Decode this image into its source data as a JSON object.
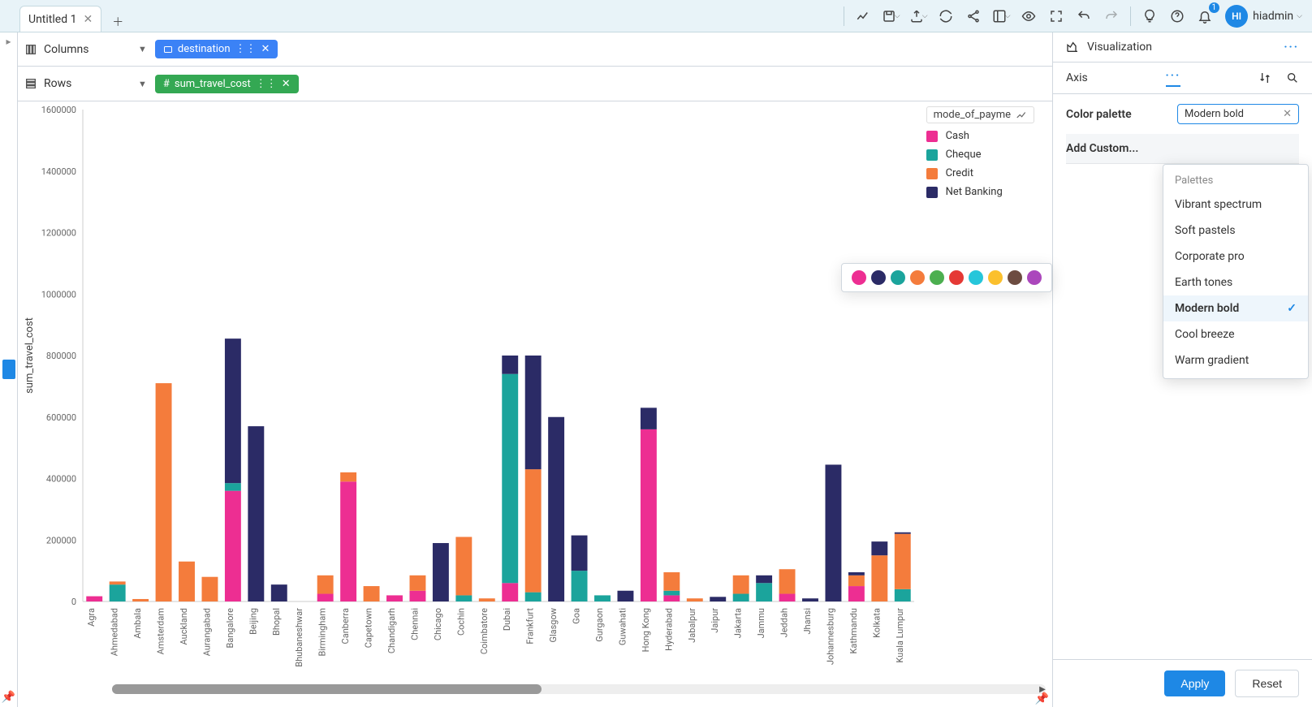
{
  "tab": {
    "title": "Untitled 1"
  },
  "user": {
    "initials": "HI",
    "name": "hiadmin"
  },
  "notif_count": "1",
  "shelves": {
    "columns_label": "Columns",
    "rows_label": "Rows",
    "column_pill": "destination",
    "row_pill": "sum_travel_cost"
  },
  "legend": {
    "title": "mode_of_payme",
    "items": [
      "Cash",
      "Cheque",
      "Credit",
      "Net Banking"
    ]
  },
  "right": {
    "title": "Visualization",
    "tab": "Axis",
    "field_label": "Color palette",
    "field_value": "Modern bold",
    "add_custom": "Add Custom...",
    "apply": "Apply",
    "reset": "Reset"
  },
  "palette_dropdown": {
    "header": "Palettes",
    "options": [
      "Vibrant spectrum",
      "Soft pastels",
      "Corporate pro",
      "Earth tones",
      "Modern bold",
      "Cool breeze",
      "Warm gradient"
    ],
    "selected": "Modern bold"
  },
  "swatches": [
    "#ed2e92",
    "#2b2b66",
    "#1ba49c",
    "#f47c3c",
    "#4caf50",
    "#e53935",
    "#26c6da",
    "#fbc02d",
    "#6d4c41",
    "#ab47bc"
  ],
  "chart_data": {
    "type": "bar",
    "stacked": true,
    "title": "",
    "xlabel": "destination",
    "ylabel": "sum_travel_cost",
    "ylim": [
      0,
      1600000
    ],
    "yticks": [
      0,
      200000,
      400000,
      600000,
      800000,
      1000000,
      1200000,
      1400000,
      1600000
    ],
    "legend_title": "mode_of_payment",
    "series_order": [
      "Cash",
      "Cheque",
      "Credit",
      "Net Banking"
    ],
    "colors": {
      "Cash": "#ed2e92",
      "Cheque": "#1ba49c",
      "Credit": "#f47c3c",
      "Net Banking": "#2b2b66"
    },
    "categories": [
      "Agra",
      "Ahmedabad",
      "Ambala",
      "Amsterdam",
      "Auckland",
      "Aurangabad",
      "Bangalore",
      "Beijing",
      "Bhopal",
      "Bhubaneshwar",
      "Birmingham",
      "Canberra",
      "Capetown",
      "Chandigarh",
      "Chennai",
      "Chicago",
      "Cochin",
      "Coimbatore",
      "Dubai",
      "Frankfurt",
      "Glasgow",
      "Goa",
      "Gurgaon",
      "Guwahati",
      "Hong Kong",
      "Hyderabad",
      "Jabalpur",
      "Jaipur",
      "Jakarta",
      "Jammu",
      "Jeddah",
      "Jhansi",
      "Johannesburg",
      "Kathmandu",
      "Kolkata",
      "Kuala Lumpur"
    ],
    "series": [
      {
        "name": "Cash",
        "values": [
          17000,
          0,
          0,
          0,
          0,
          0,
          360000,
          0,
          0,
          0,
          25000,
          390000,
          0,
          20000,
          35000,
          0,
          0,
          0,
          60000,
          0,
          0,
          0,
          0,
          0,
          560000,
          20000,
          0,
          0,
          0,
          0,
          25000,
          0,
          0,
          50000,
          0,
          0
        ]
      },
      {
        "name": "Cheque",
        "values": [
          0,
          55000,
          0,
          0,
          0,
          0,
          25000,
          0,
          0,
          0,
          0,
          0,
          0,
          0,
          0,
          0,
          20000,
          0,
          680000,
          30000,
          0,
          100000,
          20000,
          0,
          0,
          15000,
          0,
          0,
          25000,
          60000,
          0,
          0,
          0,
          0,
          0,
          40000
        ]
      },
      {
        "name": "Credit",
        "values": [
          0,
          10000,
          8000,
          710000,
          130000,
          80000,
          0,
          0,
          0,
          0,
          60000,
          30000,
          50000,
          0,
          50000,
          0,
          190000,
          10000,
          0,
          400000,
          0,
          0,
          0,
          0,
          0,
          60000,
          10000,
          0,
          60000,
          0,
          80000,
          0,
          0,
          35000,
          150000,
          180000
        ]
      },
      {
        "name": "Net Banking",
        "values": [
          0,
          0,
          0,
          0,
          0,
          0,
          470000,
          570000,
          55000,
          0,
          0,
          0,
          0,
          0,
          0,
          190000,
          0,
          0,
          60000,
          370000,
          600000,
          115000,
          0,
          35000,
          70000,
          0,
          0,
          15000,
          0,
          25000,
          0,
          10000,
          445000,
          10000,
          45000,
          5000
        ]
      }
    ]
  }
}
